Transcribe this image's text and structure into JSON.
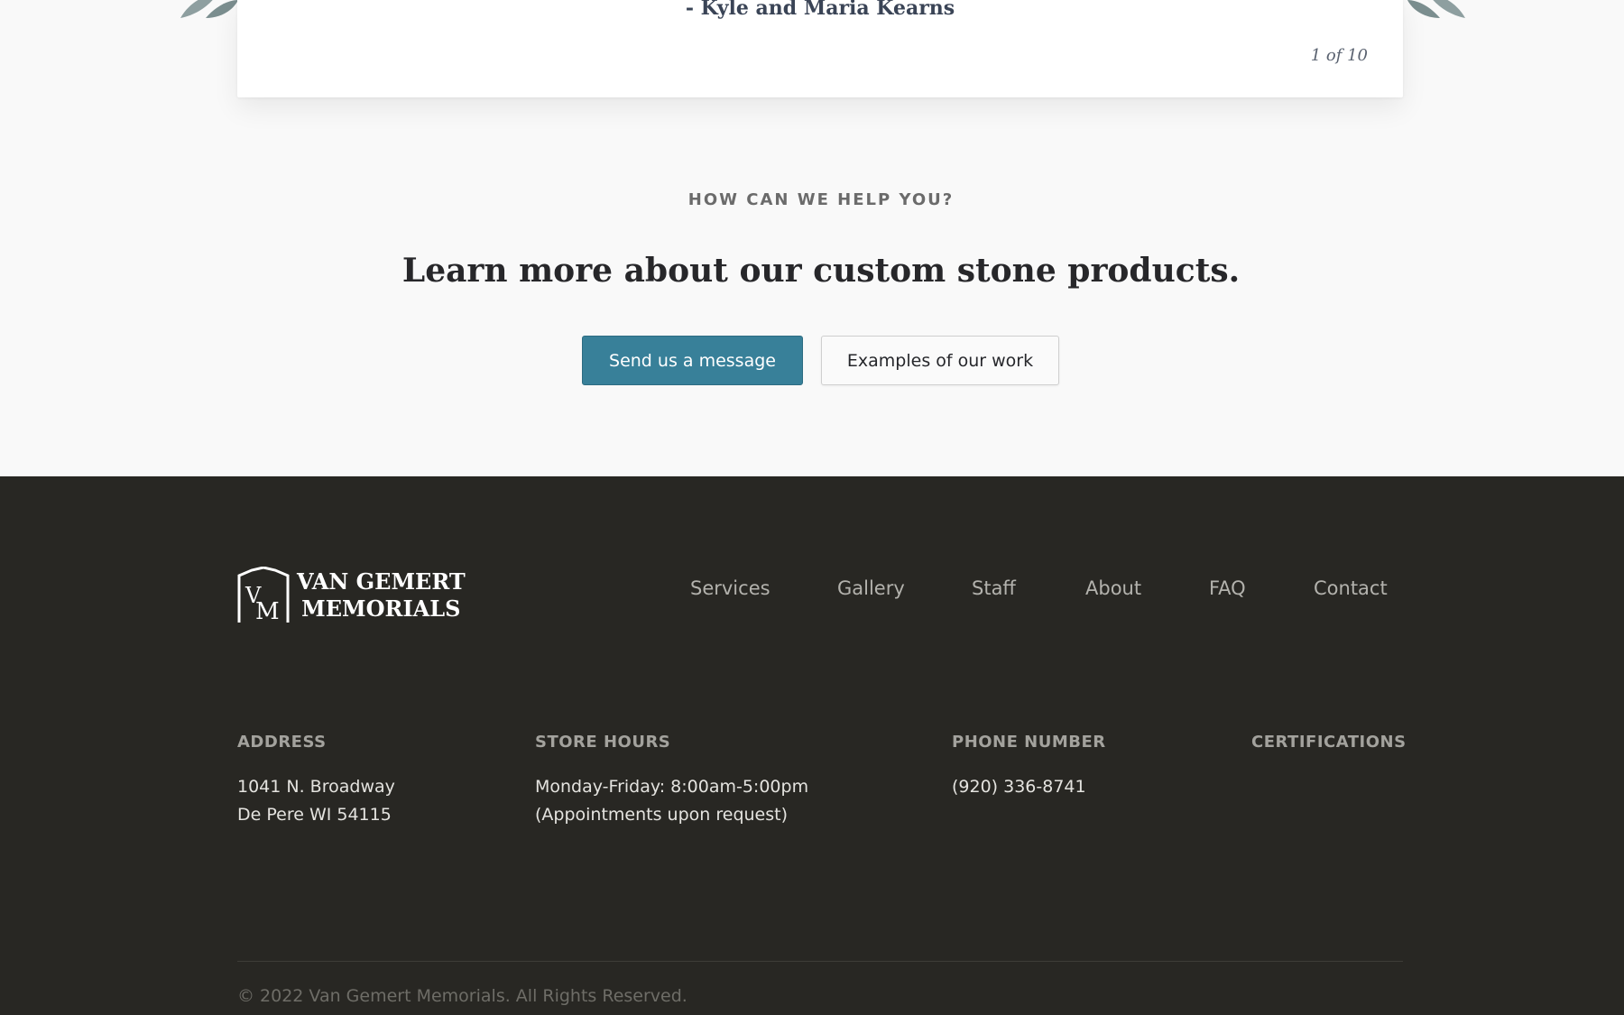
{
  "testimonial": {
    "author": "- Kyle and Maria Kearns",
    "counter": "1 of 10"
  },
  "help": {
    "eyebrow": "HOW CAN WE HELP YOU?",
    "heading": "Learn more about our custom stone products.",
    "primary_button": "Send us a message",
    "secondary_button": "Examples of our work"
  },
  "footer": {
    "logo": {
      "line1": "VAN GEMERT",
      "line2": "MEMORIALS",
      "monogram": "VM"
    },
    "nav": [
      "Services",
      "Gallery",
      "Staff",
      "About",
      "FAQ",
      "Contact"
    ],
    "address": {
      "heading": "ADDRESS",
      "line1": "1041 N. Broadway",
      "line2": "De Pere WI 54115"
    },
    "hours": {
      "heading": "STORE HOURS",
      "line1": "Monday-Friday: 8:00am-5:00pm",
      "line2": "(Appointments upon request)"
    },
    "phone": {
      "heading": "PHONE NUMBER",
      "line1": "(920) 336-8741"
    },
    "certifications": {
      "heading": "CERTIFICATIONS"
    },
    "copyright": "© 2022 Van Gemert Memorials. All Rights Reserved."
  },
  "colors": {
    "accent": "#388099",
    "footer_bg": "#282723",
    "page_bg": "#f9f9f9"
  }
}
